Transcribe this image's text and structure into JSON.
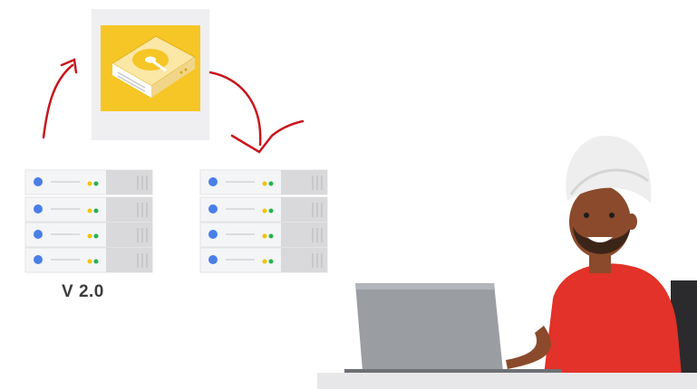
{
  "server_left": {
    "version_label": "V 2.0"
  },
  "colors": {
    "rack_body": "#f4f5f7",
    "rack_side": "#d9d9db",
    "rack_led_blue": "#4a7fe8",
    "rack_led_yellow": "#f2c200",
    "rack_led_green": "#27b24a",
    "disk_bg": "#f6c626",
    "annotation_red": "#c8161d",
    "shirt_red": "#e23229",
    "turban": "#eeeeee",
    "laptop": "#9a9ea3"
  },
  "icons": [
    "hard-disk-icon",
    "server-rack-icon",
    "person-illustration",
    "laptop-icon",
    "arrow-annotation"
  ]
}
